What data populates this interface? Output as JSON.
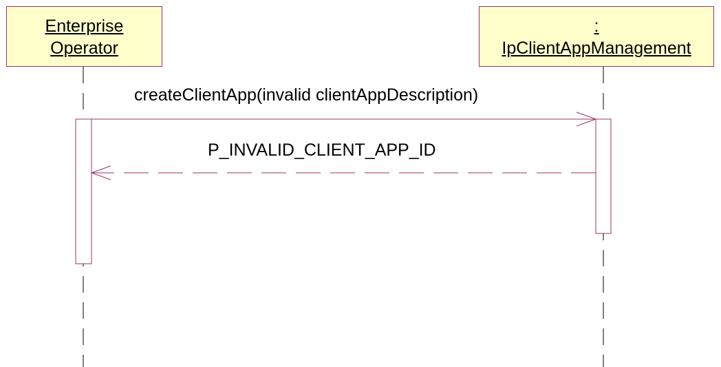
{
  "lifelines": [
    {
      "line1": "Enterprise ",
      "line2": "Operator"
    },
    {
      "line1": ":",
      "line2": "IpClientAppManagement"
    }
  ],
  "messages": {
    "call": "createClientApp(invalid clientAppDescription)",
    "return": "P_INVALID_CLIENT_APP_ID"
  },
  "colors": {
    "line": "#993366",
    "box_fill": "#ffffcc"
  }
}
